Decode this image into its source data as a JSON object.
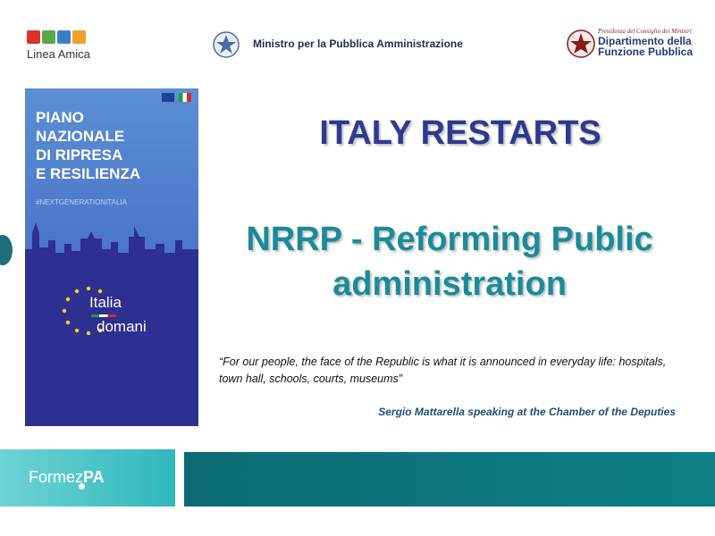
{
  "header": {
    "linea_amica": "Linea Amica",
    "ministry": "Ministro per la Pubblica Amministrazione",
    "dfp_small": "Presidenza del Consiglio dei Ministri",
    "dfp_line1": "Dipartimento della",
    "dfp_line2": "Funzione Pubblica",
    "icons": [
      "building-icon",
      "phone-icon",
      "mobile-icon",
      "email-icon"
    ]
  },
  "poster": {
    "title": "PIANO\nNAZIONALE\nDI RIPRESA\nE RESILIENZA",
    "hashtag": "#NEXTGENERATIONITALIA",
    "logo_line1": "Italia",
    "logo_line2": "domani"
  },
  "main": {
    "heading": "ITALY RESTARTS",
    "subheading": "NRRP  - Reforming Public administration",
    "quote": "“For our people, the face of the Republic is what it is announced in everyday life: hospitals, town hall, schools, courts, museums”",
    "attribution": "Sergio Mattarella speaking at the Chamber of the Deputies"
  },
  "footer": {
    "brand_a": "Formez",
    "brand_b": "PA"
  },
  "colors": {
    "heading": "#2d3a8f",
    "subheading": "#1b8a9a",
    "poster_bg": "#2d2f91",
    "footer_teal": "#0f7f86"
  }
}
